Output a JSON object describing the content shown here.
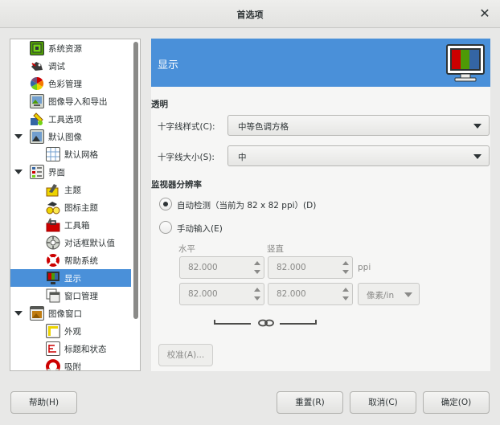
{
  "window": {
    "title": "首选项"
  },
  "tree": {
    "items": [
      {
        "label": "系统资源",
        "icon": "system-resources-icon"
      },
      {
        "label": "调试",
        "icon": "debug-icon"
      },
      {
        "label": "色彩管理",
        "icon": "color-management-icon"
      },
      {
        "label": "图像导入和导出",
        "icon": "image-import-export-icon"
      },
      {
        "label": "工具选项",
        "icon": "tool-options-icon"
      },
      {
        "label": "默认图像",
        "icon": "default-image-icon"
      },
      {
        "label": "默认网格",
        "icon": "default-grid-icon"
      },
      {
        "label": "界面",
        "icon": "interface-icon"
      },
      {
        "label": "主题",
        "icon": "theme-icon"
      },
      {
        "label": "图标主题",
        "icon": "icon-theme-icon"
      },
      {
        "label": "工具箱",
        "icon": "toolbox-icon"
      },
      {
        "label": "对话框默认值",
        "icon": "dialog-defaults-icon"
      },
      {
        "label": "帮助系统",
        "icon": "help-system-icon"
      },
      {
        "label": "显示",
        "icon": "display-icon"
      },
      {
        "label": "窗口管理",
        "icon": "window-management-icon"
      },
      {
        "label": "图像窗口",
        "icon": "image-windows-icon"
      },
      {
        "label": "外观",
        "icon": "appearance-icon"
      },
      {
        "label": "标题和状态",
        "icon": "title-status-icon"
      },
      {
        "label": "吸附",
        "icon": "snapping-icon"
      }
    ]
  },
  "panel": {
    "title": "显示",
    "icon": "display-icon",
    "transparency": {
      "section": "透明",
      "check_style_label": "十字线样式(C):",
      "check_style_value": "中等色调方格",
      "check_size_label": "十字线大小(S):",
      "check_size_value": "中"
    },
    "resolution": {
      "section": "监视器分辨率",
      "auto_label": "自动检测（当前为 82 x 82 ppi）(D)",
      "manual_label": "手动输入(E)",
      "horizontal_label": "水平",
      "vertical_label": "竖直",
      "h_value_1": "82.000",
      "v_value_1": "82.000",
      "h_value_2": "82.000",
      "v_value_2": "82.000",
      "unit_ppi": "ppi",
      "unit_select": "像素/in",
      "calibrate_label": "校准(A)..."
    }
  },
  "footer": {
    "help_label": "帮助(H)",
    "reset_label": "重置(R)",
    "cancel_label": "取消(C)",
    "ok_label": "确定(O)"
  },
  "colors": {
    "accent": "#4a90d9"
  }
}
